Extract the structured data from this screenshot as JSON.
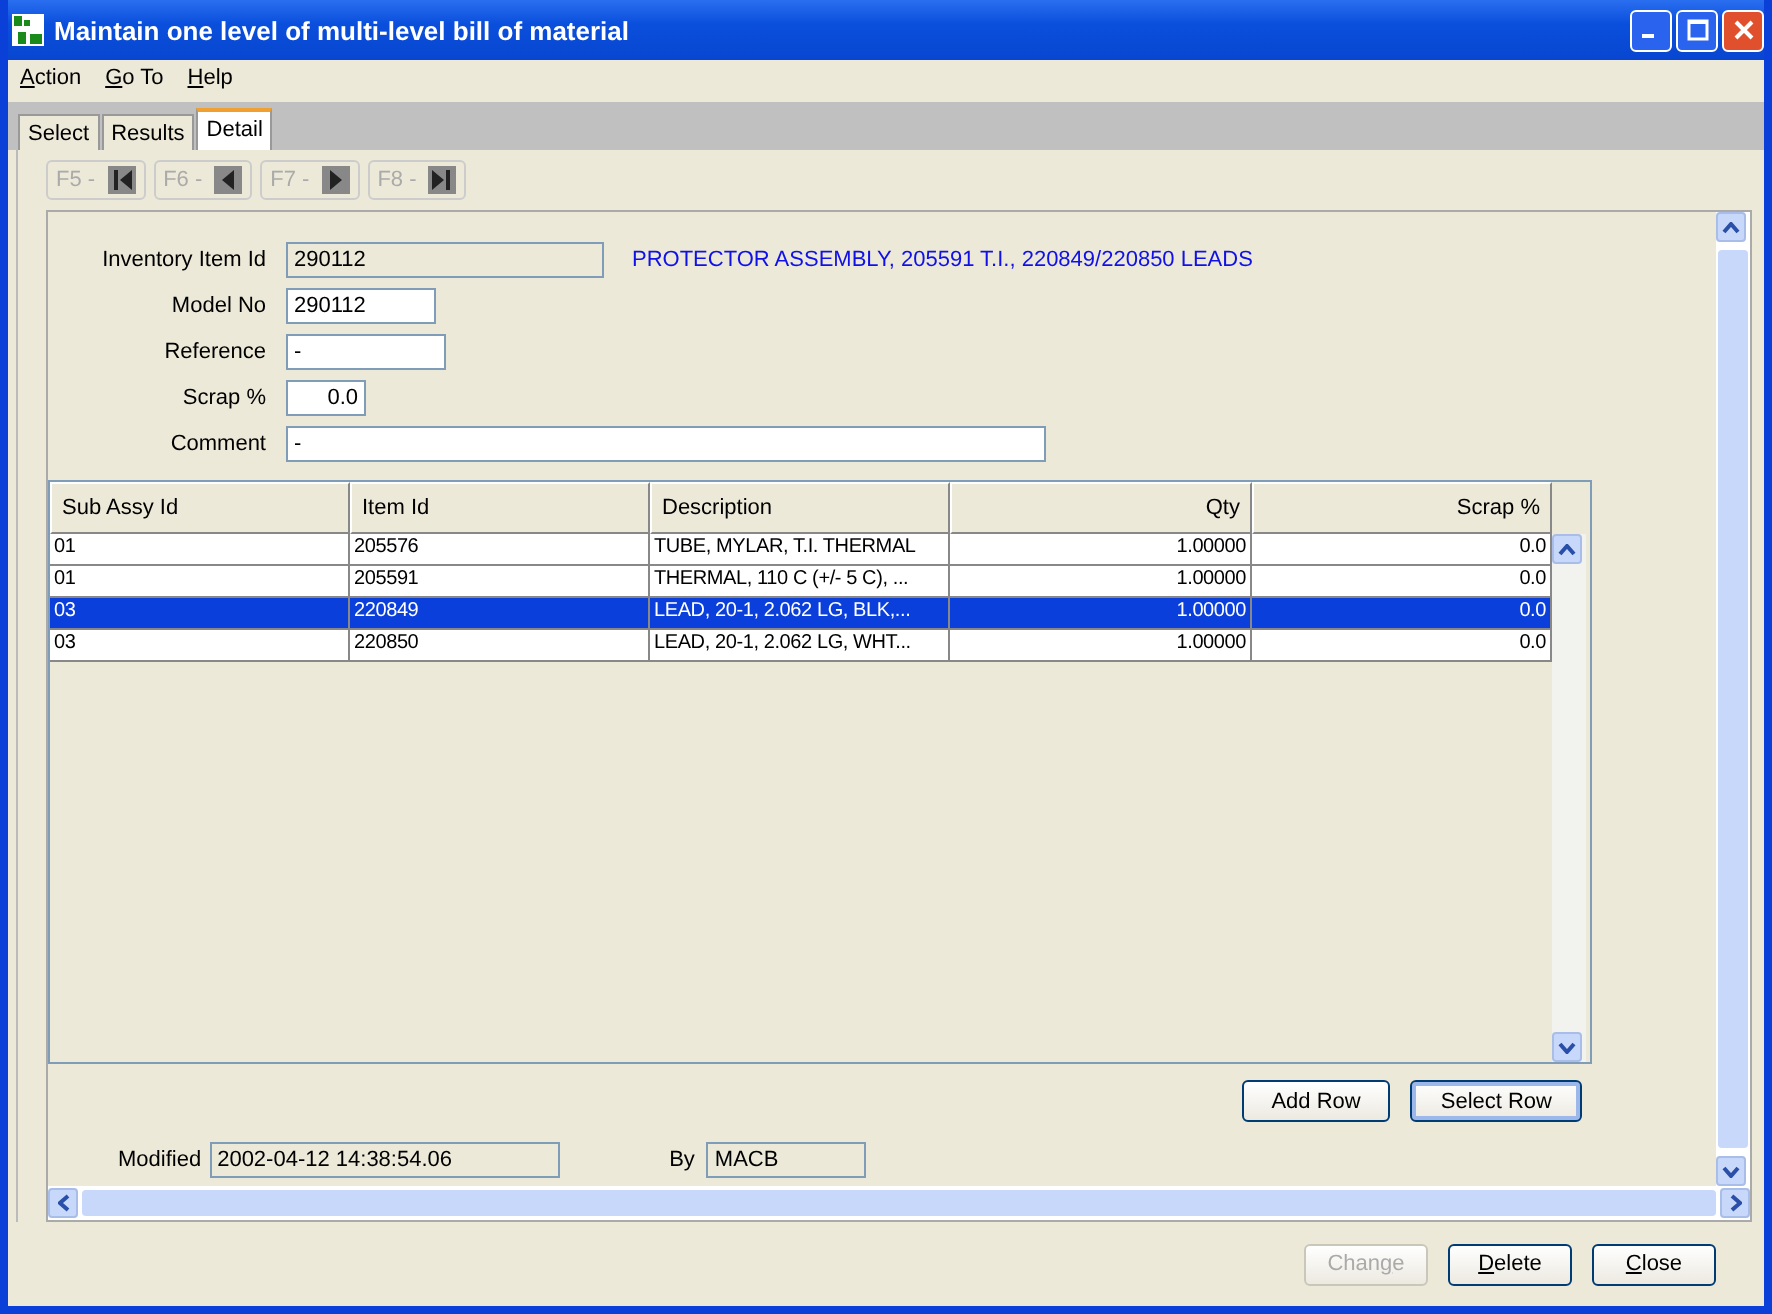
{
  "window": {
    "title": "Maintain one level of multi-level bill of material"
  },
  "menu": [
    {
      "label": "Action"
    },
    {
      "label": "Go To"
    },
    {
      "label": "Help"
    }
  ],
  "tabs": [
    {
      "label": "Select",
      "selected": false
    },
    {
      "label": "Results",
      "selected": false
    },
    {
      "label": "Detail",
      "selected": true
    }
  ],
  "nav_buttons": [
    {
      "label": "F5 -",
      "kind": "first",
      "disabled": true
    },
    {
      "label": "F6 -",
      "kind": "prev",
      "disabled": true
    },
    {
      "label": "F7 -",
      "kind": "next",
      "disabled": true
    },
    {
      "label": "F8 -",
      "kind": "last",
      "disabled": true
    }
  ],
  "form": {
    "inventory_item_id": {
      "label": "Inventory Item Id",
      "value": "290112"
    },
    "description": "PROTECTOR ASSEMBLY, 205591 T.I., 220849/220850 LEADS",
    "fields": [
      {
        "label": "Model No",
        "value": "290112",
        "kind": "short"
      },
      {
        "label": "Reference",
        "value": "-",
        "kind": "medium"
      },
      {
        "label": "Scrap %",
        "value": "0.0",
        "kind": "number"
      },
      {
        "label": "Comment",
        "value": "-",
        "kind": "long"
      }
    ]
  },
  "table": {
    "columns": [
      "Sub Assy Id",
      "Item Id",
      "Description",
      "Qty",
      "Scrap %"
    ],
    "rows": [
      {
        "cells": [
          "01",
          "205576",
          "TUBE, MYLAR, T.I. THERMAL",
          "1.00000",
          "0.0"
        ],
        "selected": false
      },
      {
        "cells": [
          "01",
          "205591",
          "THERMAL, 110 C (+/-  5 C), ...",
          "1.00000",
          "0.0"
        ],
        "selected": false
      },
      {
        "cells": [
          "03",
          "220849",
          "LEAD, 20-1,  2.062 LG, BLK,...",
          "1.00000",
          "0.0"
        ],
        "selected": true
      },
      {
        "cells": [
          "03",
          "220850",
          "LEAD, 20-1,  2.062 LG, WHT...",
          "1.00000",
          "0.0"
        ],
        "selected": false
      }
    ]
  },
  "table_buttons": [
    {
      "label": "Add Row",
      "focused": false
    },
    {
      "label": "Select Row",
      "focused": true
    }
  ],
  "audit": {
    "modified_label": "Modified",
    "modified": "2002-04-12 14:38:54.06",
    "by_label": "By",
    "by": "MACB"
  },
  "buttons": [
    {
      "label": "Change",
      "disabled": true
    },
    {
      "label": "Delete",
      "disabled": false
    },
    {
      "label": "Close",
      "disabled": false
    }
  ]
}
